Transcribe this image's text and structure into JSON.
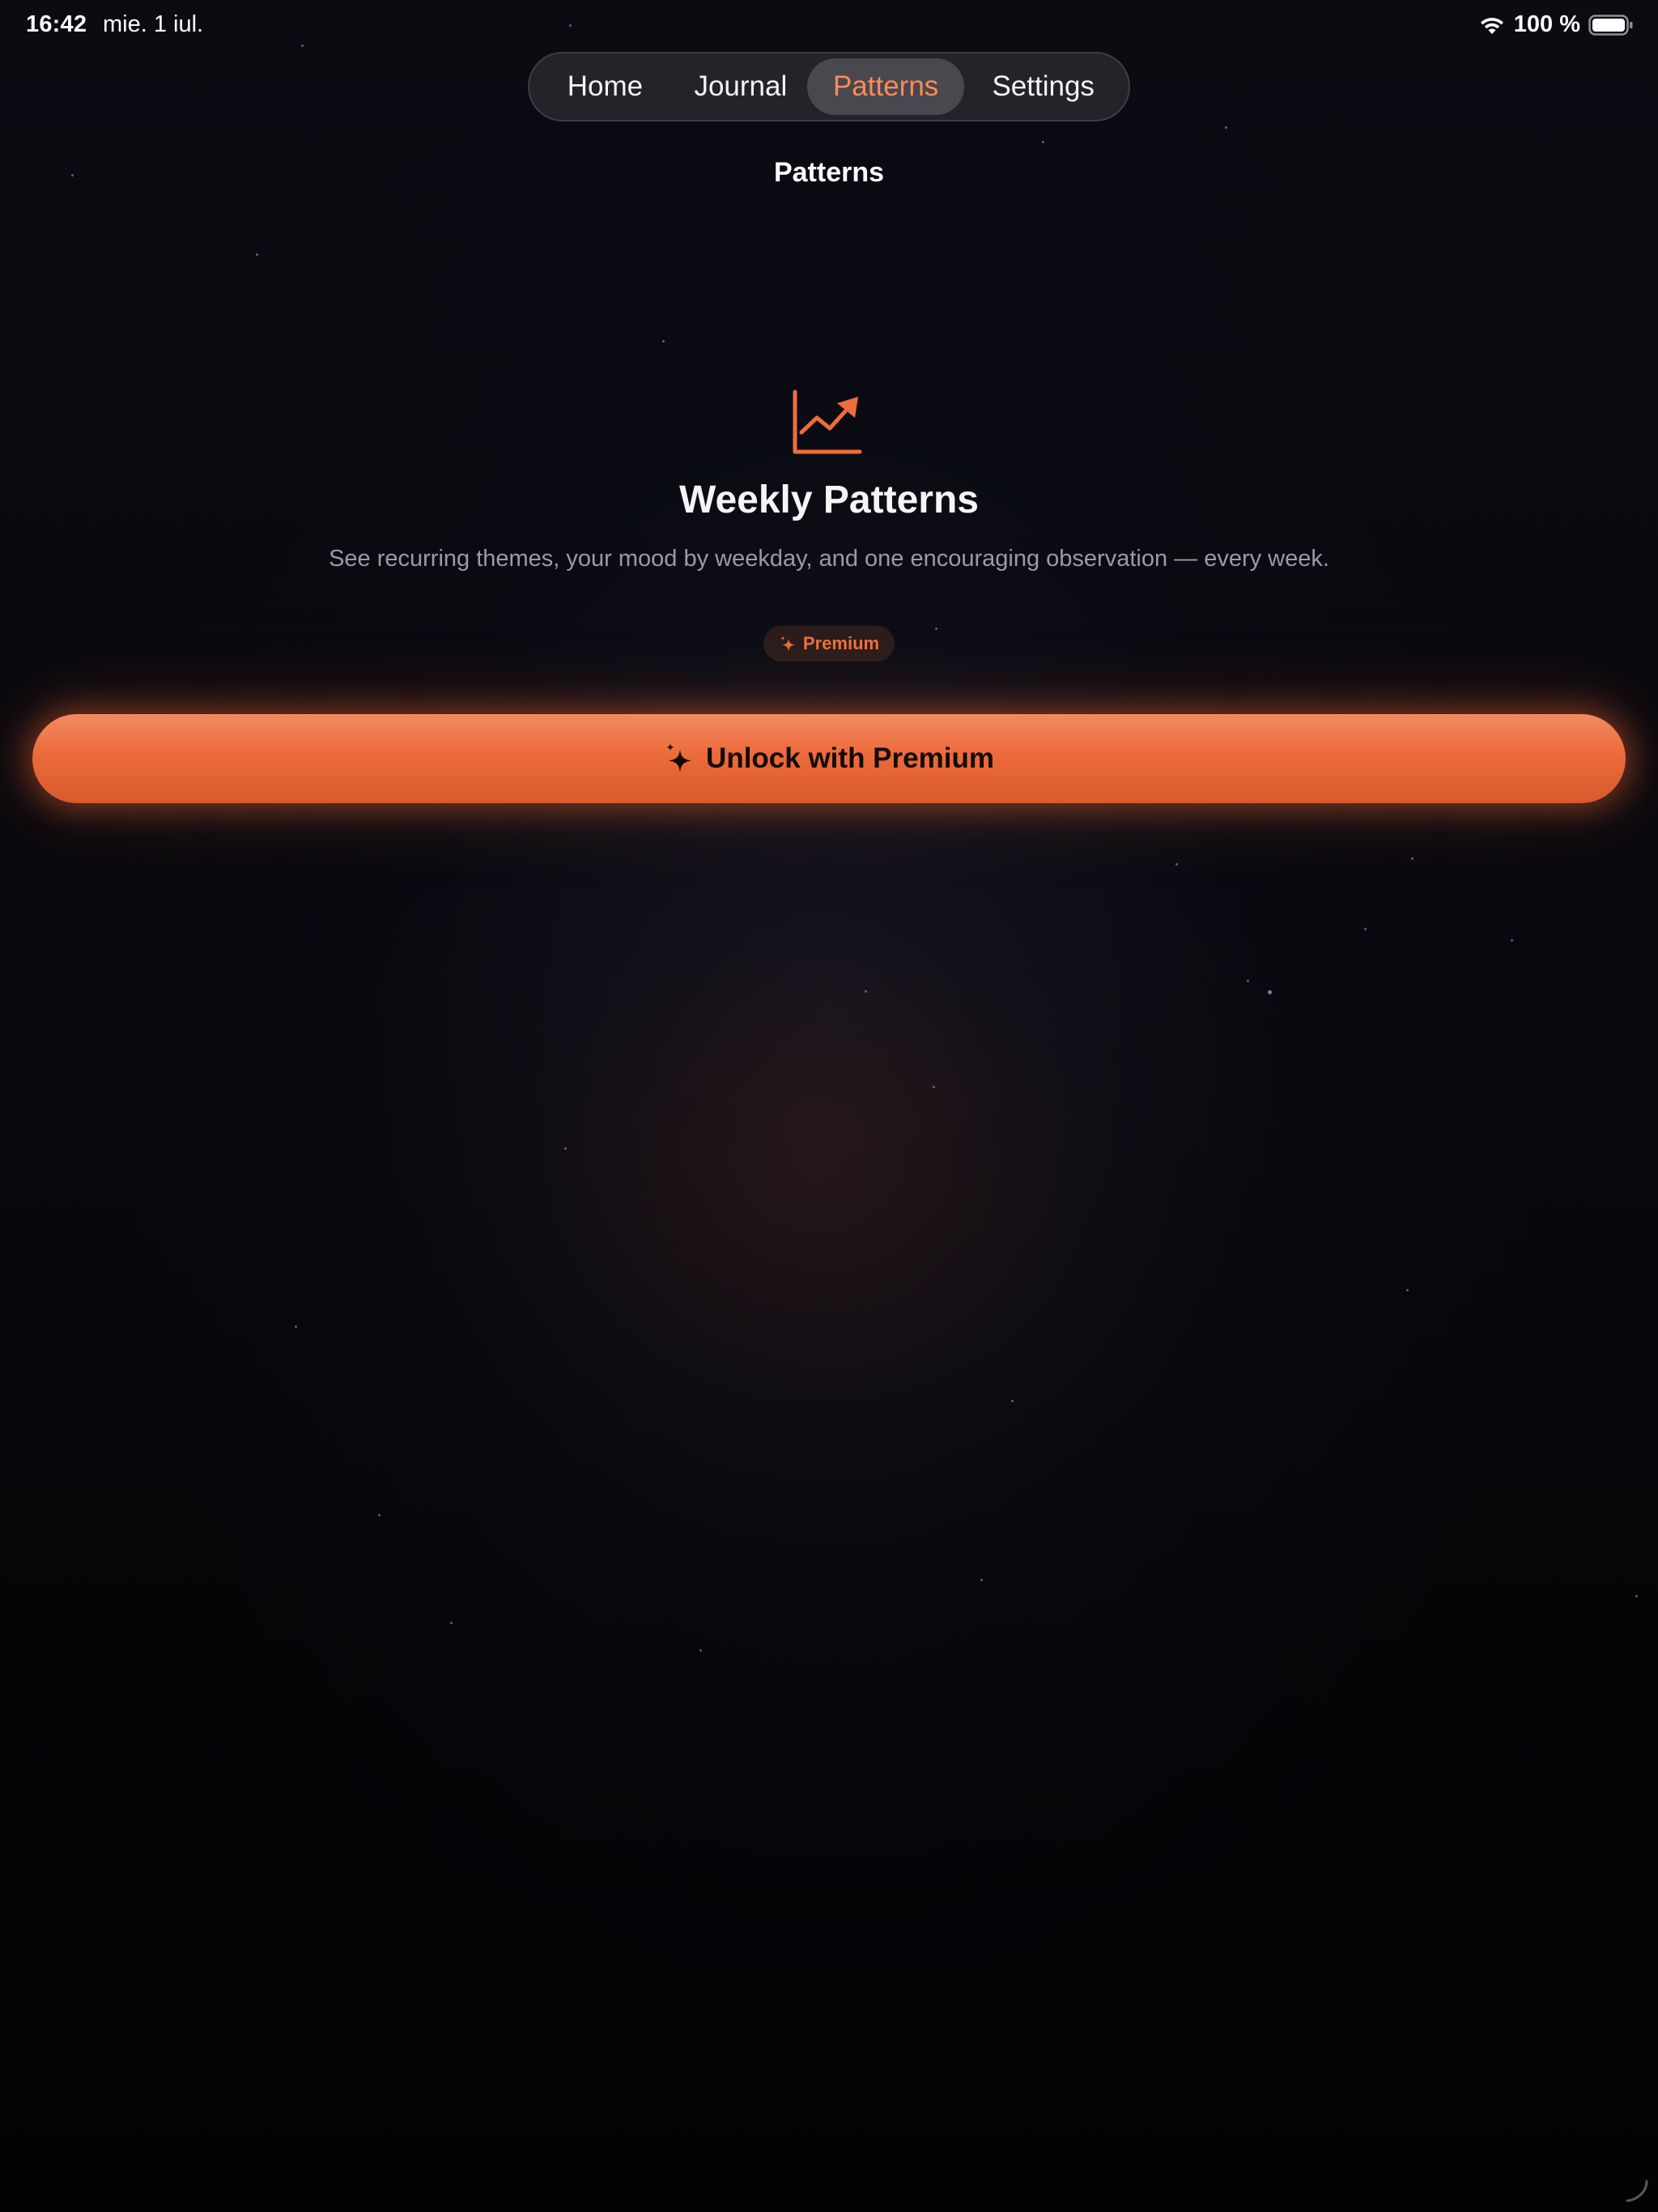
{
  "status_bar": {
    "time": "16:42",
    "date": "mie. 1 iul.",
    "battery": "100 %",
    "icons": [
      "wifi-icon",
      "battery-icon"
    ]
  },
  "nav": {
    "tabs": [
      {
        "label": "Home",
        "selected": false
      },
      {
        "label": "Journal",
        "selected": false
      },
      {
        "label": "Patterns",
        "selected": true
      },
      {
        "label": "Settings",
        "selected": false
      }
    ]
  },
  "page": {
    "title": "Patterns"
  },
  "feature": {
    "icon": "trending-chart-icon",
    "title": "Weekly Patterns",
    "description": "See recurring themes, your mood by weekday, and one encouraging observation — every week.",
    "badge_label": "Premium",
    "badge_icon": "sparkle-icon"
  },
  "cta": {
    "label": "Unlock with Premium",
    "icon": "sparkles-icon"
  },
  "colors": {
    "accent": "#ec6b3b",
    "accent_text": "#ff8a55",
    "background": "#08080d",
    "nav_background": "#26262c",
    "nav_selected": "#48484e",
    "muted_text": "#9b9ba3"
  }
}
